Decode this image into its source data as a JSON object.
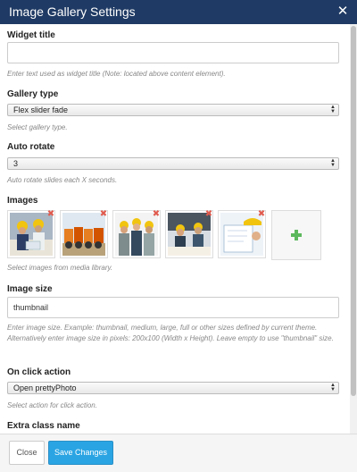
{
  "dialog": {
    "title": "Image Gallery Settings",
    "close_glyph": "✕"
  },
  "fields": {
    "widget_title": {
      "label": "Widget title",
      "value": "",
      "description": "Enter text used as widget title (Note: located above content element)."
    },
    "gallery_type": {
      "label": "Gallery type",
      "selected": "Flex slider fade",
      "description": "Select gallery type."
    },
    "auto_rotate": {
      "label": "Auto rotate",
      "selected": "3",
      "description": "Auto rotate slides each X seconds."
    },
    "images": {
      "label": "Images",
      "description": "Select images from media library.",
      "thumbnails": [
        {
          "subject": "workers-reviewing-plans"
        },
        {
          "subject": "construction-machines"
        },
        {
          "subject": "group-of-engineers"
        },
        {
          "subject": "workers-at-desk"
        },
        {
          "subject": "hard-hat-and-blueprints"
        }
      ],
      "add_icon": "plus-icon"
    },
    "image_size": {
      "label": "Image size",
      "value": "thumbnail",
      "description": "Enter image size. Example: thumbnail, medium, large, full or other sizes defined by current theme. Alternatively enter image size in pixels: 200x100 (Width x Height). Leave empty to use \"thumbnail\" size."
    },
    "on_click_action": {
      "label": "On click action",
      "selected": "Open prettyPhoto",
      "description": "Select action for click action."
    },
    "extra_class_name": {
      "label": "Extra class name"
    }
  },
  "footer": {
    "close_label": "Close",
    "save_label": "Save Changes"
  },
  "colors": {
    "header_bg": "#1f3a64",
    "save_button": "#2aa4e3",
    "remove_icon": "#e05b4e",
    "add_icon": "#5cb85c"
  }
}
